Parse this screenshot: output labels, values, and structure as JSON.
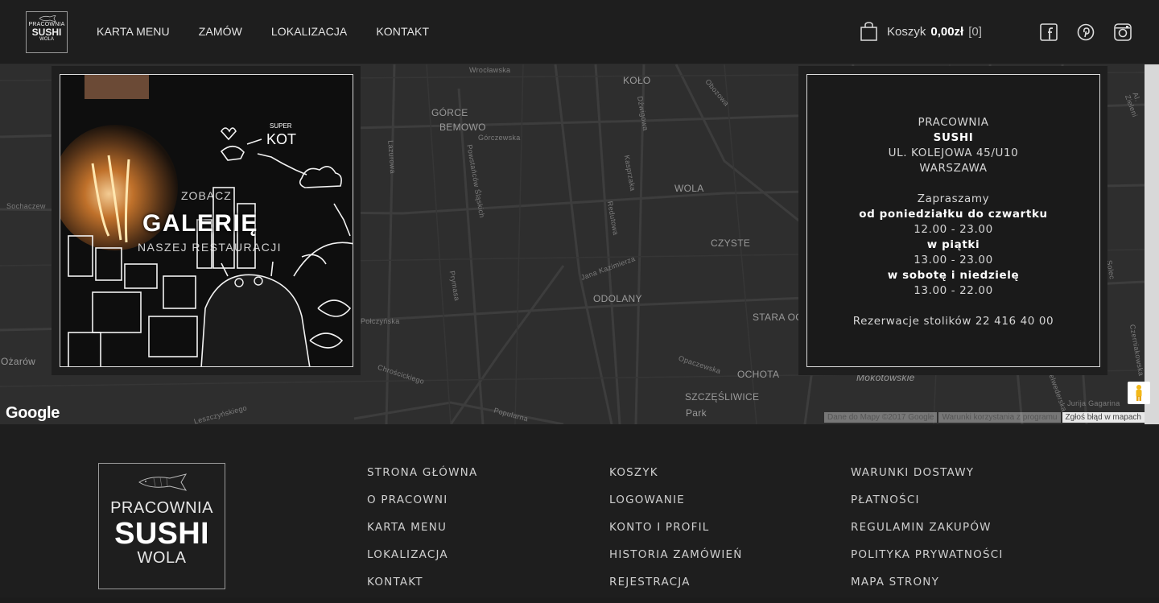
{
  "header": {
    "logo": {
      "line1": "PRACOWNIA",
      "line2": "SUSHI",
      "line3": "WOLA"
    },
    "nav": [
      "KARTA MENU",
      "ZAMÓW",
      "LOKALIZACJA",
      "KONTAKT"
    ],
    "cart": {
      "label": "Koszyk",
      "amount": "0,00zł",
      "count": "[0]"
    },
    "social": [
      "facebook-icon",
      "pinterest-icon",
      "instagram-icon"
    ]
  },
  "map": {
    "labels": [
      "Wrocławska",
      "KOŁO",
      "GÓRCE",
      "BEMOWO",
      "Górczewska",
      "WOLA",
      "CZYSTE",
      "ODOLANY",
      "STARA OC",
      "OCHOTA",
      "SZCZĘŚLIWICE",
      "Park",
      "Mokotowskie",
      "Ożarów",
      "Sochaczew",
      "Połczyńska",
      "Chrościckiego",
      "Popularna",
      "Jana Kazimierza",
      "Prymasa",
      "Lazurowa",
      "Powstańców Śląskich",
      "Redutowa",
      "Dźwigowa",
      "Kasprzaka",
      "Opaczewska",
      "Obozowa",
      "Leszczyńskiego",
      "Solec",
      "Czerniakowska",
      "Jurija Gagarina",
      "Belwederska",
      "Al. Zieleni"
    ],
    "google": "Google",
    "footer": [
      "Dane do Mapy ©2017 Google",
      "Warunki korzystania z programu",
      "Zgłoś błąd w mapach"
    ]
  },
  "gallery": {
    "see": "ZOBACZ",
    "title": "GALERIĘ",
    "subtitle": "NASZEJ RESTAURACJI",
    "doodle": {
      "super": "SUPER",
      "kot": "KOT"
    }
  },
  "info": {
    "name1": "PRACOWNIA",
    "name2": "SUSHI",
    "address": "UL. KOLEJOWA 45/U10",
    "city": "WARSZAWA",
    "invite": "Zapraszamy",
    "days1": "od poniedziałku do czwartku",
    "hours1": "12.00 - 23.00",
    "days2": "w piątki",
    "hours2": "13.00 - 23.00",
    "days3": "w sobotę i niedzielę",
    "hours3": "13.00 - 22.00",
    "reservation": "Rezerwacje stolików 22 416 40 00"
  },
  "footer": {
    "logo": {
      "line1": "PRACOWNIA",
      "line2": "SUSHI",
      "line3": "WOLA"
    },
    "col1": [
      "STRONA GŁÓWNA",
      "O PRACOWNI",
      "KARTA MENU",
      "LOKALIZACJA",
      "KONTAKT"
    ],
    "col2": [
      "KOSZYK",
      "LOGOWANIE",
      "KONTO I PROFIL",
      "HISTORIA ZAMÓWIEŃ",
      "REJESTRACJA"
    ],
    "col3": [
      "WARUNKI DOSTAWY",
      "PŁATNOŚCI",
      "REGULAMIN ZAKUPÓW",
      "POLITYKA PRYWATNOŚCI",
      "MAPA STRONY"
    ]
  }
}
